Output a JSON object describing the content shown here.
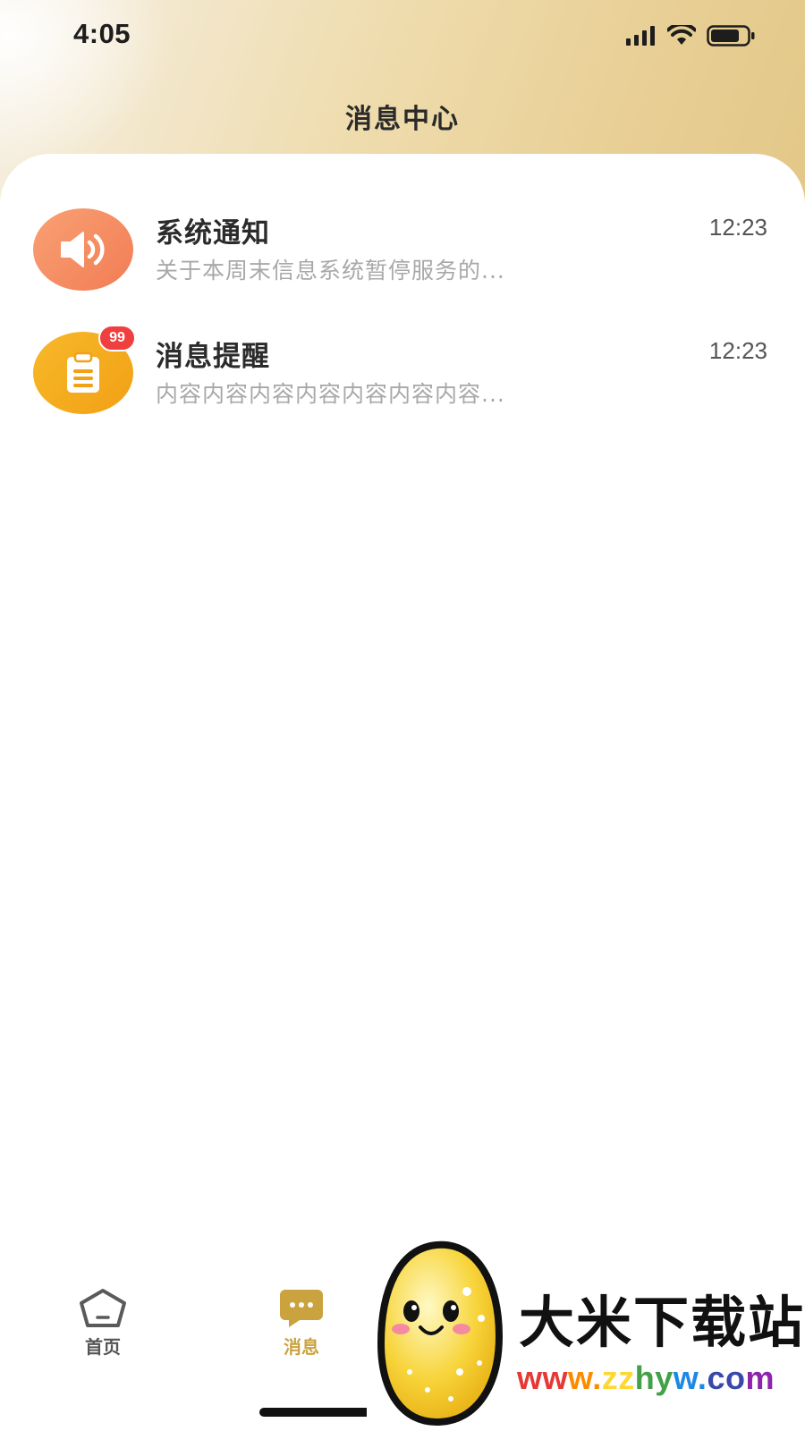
{
  "status_bar": {
    "time": "4:05",
    "icons": [
      "signal-icon",
      "wifi-icon",
      "battery-icon"
    ]
  },
  "header": {
    "title": "消息中心"
  },
  "messages": [
    {
      "icon": "speaker-icon",
      "title": "系统通知",
      "preview": "关于本周末信息系统暂停服务的...",
      "time": "12:23",
      "badge": ""
    },
    {
      "icon": "clipboard-icon",
      "title": "消息提醒",
      "preview": "内容内容内容内容内容内容内容...",
      "time": "12:23",
      "badge": "99"
    }
  ],
  "tab_bar": {
    "items": [
      {
        "label": "首页",
        "icon": "home-icon",
        "active": false
      },
      {
        "label": "消息",
        "icon": "chat-bubble-icon",
        "active": true
      }
    ]
  },
  "watermark": {
    "name": "大米下载站",
    "url": "www.zzhyw.com"
  },
  "colors": {
    "accent_gold": "#caa23e",
    "avatar_orange": "#f27c54",
    "avatar_amber": "#f2a014",
    "badge_red": "#ef3f3f"
  }
}
